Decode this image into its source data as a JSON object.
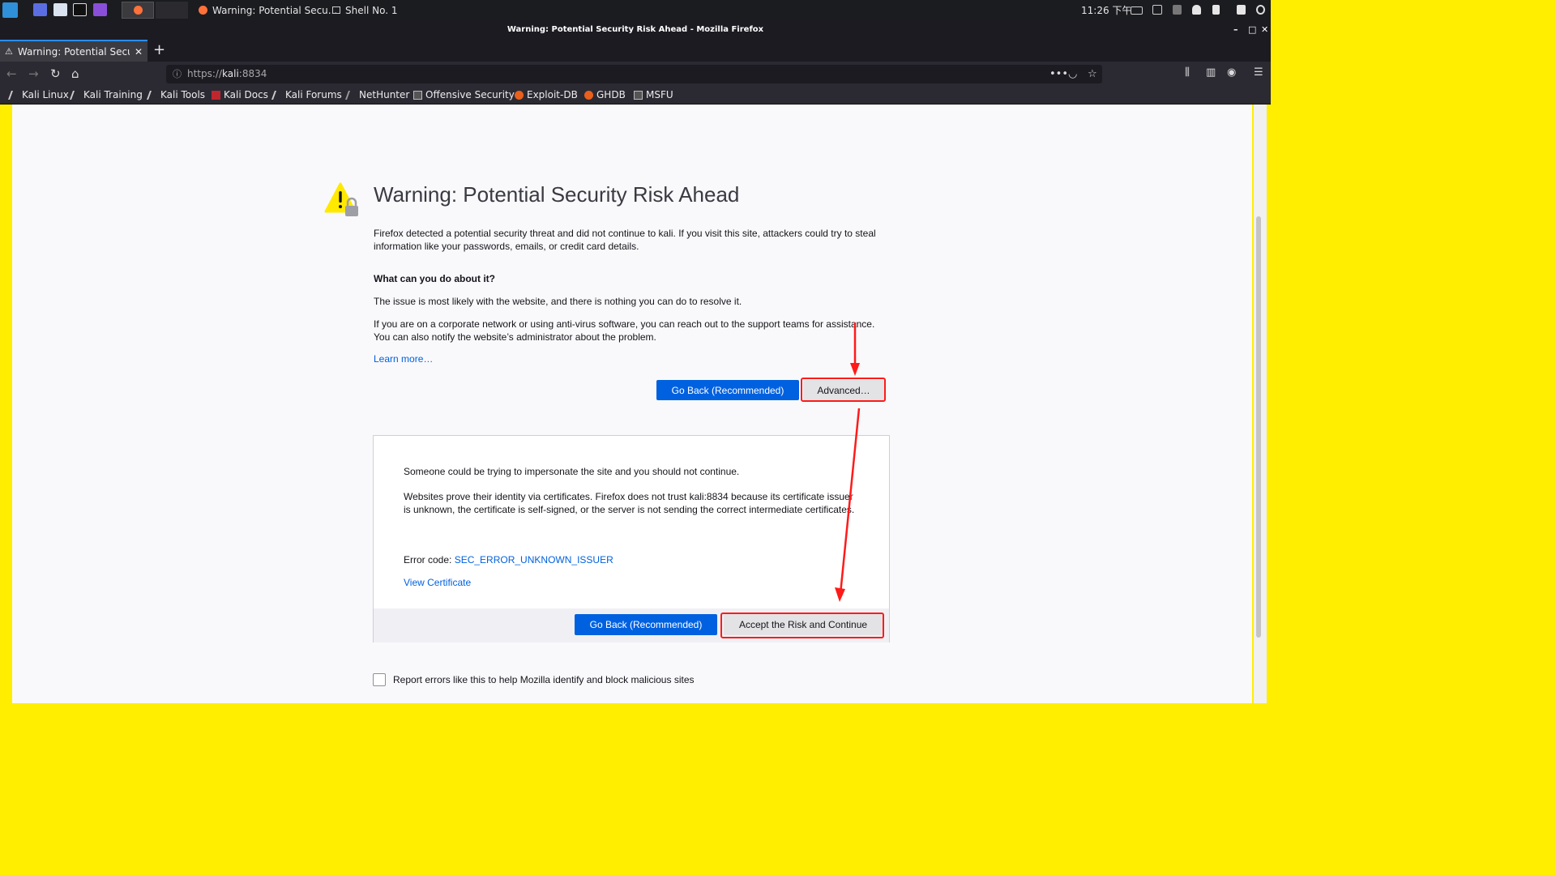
{
  "taskbar": {
    "windows": [
      {
        "label": "Warning: Potential Secu...",
        "icon": "firefox-icon"
      },
      {
        "label": "Shell No. 1",
        "icon": "terminal-icon"
      }
    ],
    "clock": "11:26 下午"
  },
  "window": {
    "title": "Warning: Potential Security Risk Ahead - Mozilla Firefox"
  },
  "tabs": [
    {
      "label": "Warning: Potential Security Risk Ahead",
      "icon": "warning-icon"
    }
  ],
  "urlbar": {
    "scheme": "https://",
    "host": "kali",
    "port": ":8834"
  },
  "bookmarks": [
    "Kali Linux",
    "Kali Training",
    "Kali Tools",
    "Kali Docs",
    "Kali Forums",
    "NetHunter",
    "Offensive Security",
    "Exploit-DB",
    "GHDB",
    "MSFU"
  ],
  "page": {
    "title": "Warning: Potential Security Risk Ahead",
    "intro": "Firefox detected a potential security threat and did not continue to kali. If you visit this site, attackers could try to steal information like your passwords, emails, or credit card details.",
    "what_heading": "What can you do about it?",
    "issue_text": "The issue is most likely with the website, and there is nothing you can do to resolve it.",
    "corp_text": "If you are on a corporate network or using anti-virus software, you can reach out to the support teams for assistance. You can also notify the website’s administrator about the problem.",
    "learn_more": "Learn more…",
    "go_back": "Go Back (Recommended)",
    "advanced": "Advanced…",
    "adv_impersonate": "Someone could be trying to impersonate the site and you should not continue.",
    "adv_cert": "Websites prove their identity via certificates. Firefox does not trust kali:8834 because its certificate issuer is unknown, the certificate is self-signed, or the server is not sending the correct intermediate certificates.",
    "error_code_label": "Error code: ",
    "error_code": "SEC_ERROR_UNKNOWN_ISSUER",
    "view_certificate": "View Certificate",
    "accept_risk": "Accept the Risk and Continue",
    "report_label": "Report errors like this to help Mozilla identify and block malicious sites"
  },
  "colors": {
    "primary_button": "#0061e0",
    "link": "#0060df",
    "annotation": "#ff1a1a",
    "frame": "#ffee00"
  }
}
